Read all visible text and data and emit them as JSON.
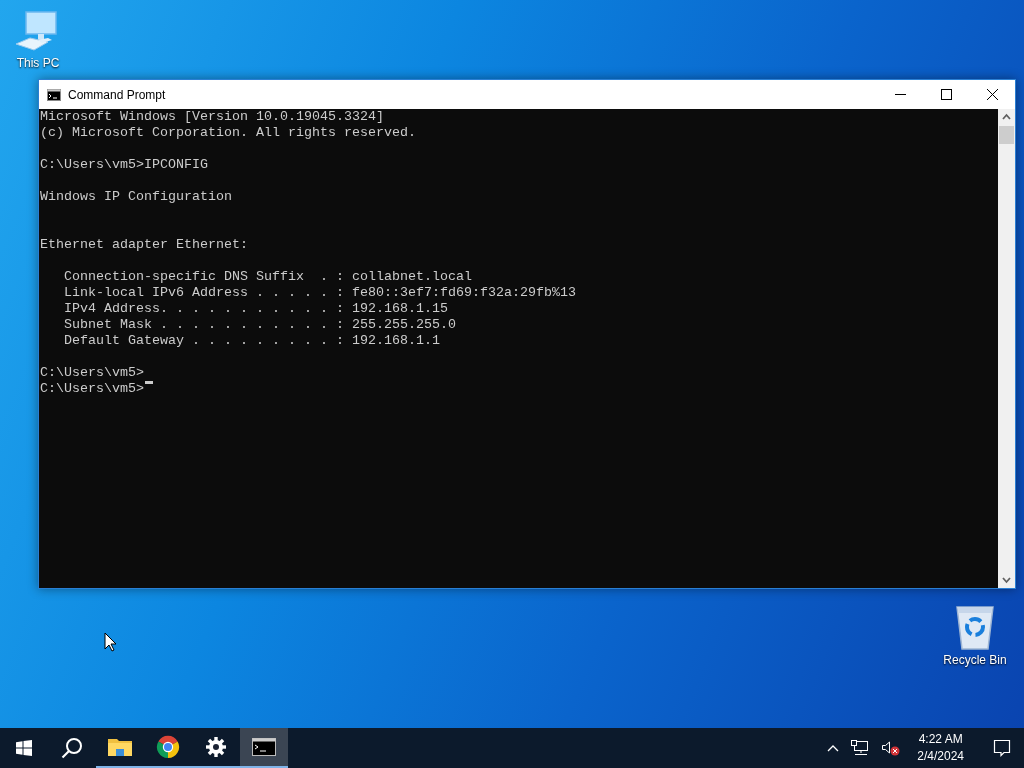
{
  "desktop_icons": [
    {
      "kind": "computer",
      "label": "This PC"
    },
    {
      "kind": "recycle-bin",
      "label": "Recycle Bin"
    }
  ],
  "window": {
    "title": "Command Prompt"
  },
  "console": {
    "lines": [
      {
        "kind": "text",
        "text": "Microsoft Windows [Version 10.0.19045.3324]"
      },
      {
        "kind": "text",
        "text": "(c) Microsoft Corporation. All rights reserved."
      },
      {
        "kind": "blank"
      },
      {
        "kind": "text",
        "text": "C:\\Users\\vm5>IPCONFIG"
      },
      {
        "kind": "blank"
      },
      {
        "kind": "text",
        "text": "Windows IP Configuration"
      },
      {
        "kind": "blank"
      },
      {
        "kind": "blank"
      },
      {
        "kind": "text",
        "text": "Ethernet adapter Ethernet:"
      },
      {
        "kind": "blank"
      },
      {
        "kind": "text",
        "text": "   Connection-specific DNS Suffix  . : collabnet.local"
      },
      {
        "kind": "text",
        "text": "   Link-local IPv6 Address . . . . . : fe80::3ef7:fd69:f32a:29fb%13"
      },
      {
        "kind": "text",
        "text": "   IPv4 Address. . . . . . . . . . . : 192.168.1.15"
      },
      {
        "kind": "text",
        "text": "   Subnet Mask . . . . . . . . . . . : 255.255.255.0"
      },
      {
        "kind": "text",
        "text": "   Default Gateway . . . . . . . . . : 192.168.1.1"
      },
      {
        "kind": "blank"
      },
      {
        "kind": "text",
        "text": "C:\\Users\\vm5>"
      },
      {
        "kind": "text",
        "text": "C:\\Users\\vm5>"
      }
    ],
    "cursor": true
  },
  "taskbar": {
    "items": [
      {
        "kind": "start",
        "running": false,
        "selected": false
      },
      {
        "kind": "search",
        "running": false,
        "selected": false
      },
      {
        "kind": "file-explorer",
        "running": true,
        "selected": false
      },
      {
        "kind": "browser",
        "running": true,
        "selected": false
      },
      {
        "kind": "settings",
        "running": true,
        "selected": false
      },
      {
        "kind": "terminal",
        "running": true,
        "selected": true
      }
    ],
    "tray": {
      "volume_muted": true,
      "time": "4:22 AM",
      "date": "2/4/2024"
    }
  }
}
